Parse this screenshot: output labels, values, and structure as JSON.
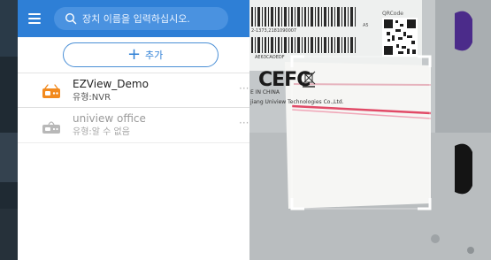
{
  "search": {
    "placeholder": "장치 이름을 입력하십시오."
  },
  "toolbar": {
    "add_label": "추가"
  },
  "devices": [
    {
      "name": "EZView_Demo",
      "type": "유형:NVR",
      "status": "online",
      "icon": "nvr-device-icon"
    },
    {
      "name": "uniview office",
      "type": "유형:알 수 없음",
      "status": "offline",
      "icon": "offline-device-icon"
    }
  ],
  "camera_view": {
    "label_text": "E IN CHINA",
    "manufacturer_text": "jiang Uniview Technologies Co.,Ltd.",
    "qr_label": "QRCode",
    "cert_text": "CEFC",
    "serial_text": "2-1373,2181090007",
    "code_text": "AE63CAOEDF",
    "badge_text": "A5"
  },
  "colors": {
    "topbar": "#2e7fd6",
    "accent": "#2f80d6",
    "online_icon": "#f28a1e",
    "offline_icon": "#b8b8b8"
  }
}
